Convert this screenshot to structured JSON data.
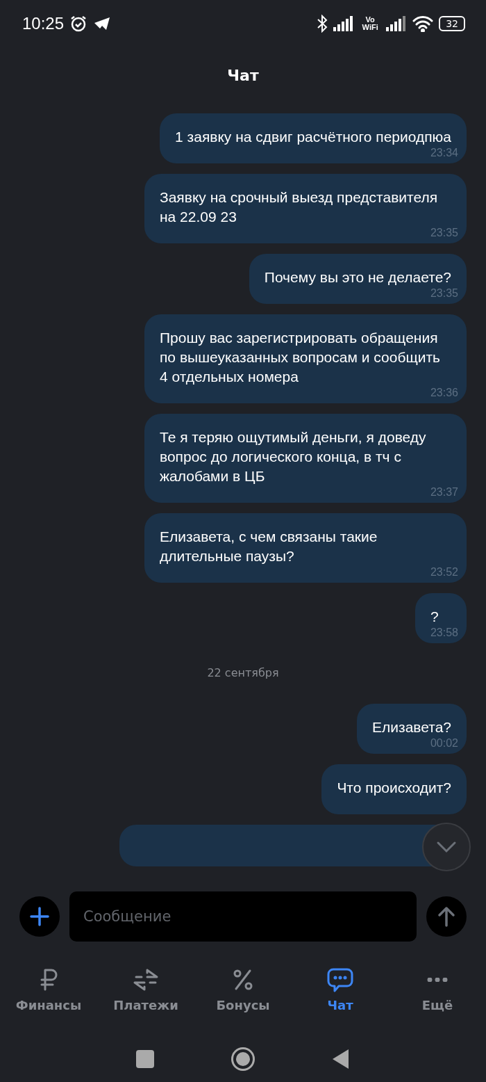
{
  "status_bar": {
    "time": "10:25",
    "network_label": "Vo WiFi",
    "battery": "32"
  },
  "header": {
    "title": "Чат"
  },
  "messages": [
    {
      "kind": "message",
      "text": "1 заявку на сдвиг расчётного периодпюа",
      "time": "23:34"
    },
    {
      "kind": "message",
      "text": "Заявку на срочный выезд представителя на 22.09 23",
      "time": "23:35"
    },
    {
      "kind": "message",
      "text": "Почему вы это не делаете?",
      "time": "23:35"
    },
    {
      "kind": "message",
      "text": "Прошу вас зарегистрировать обращения по вышеуказанных вопросам и сообщить 4 отдельных номера",
      "time": "23:36"
    },
    {
      "kind": "message",
      "text": "Те я теряю ощутимый деньги, я доведу вопрос до логического конца, в тч с жалобами в ЦБ",
      "time": "23:37"
    },
    {
      "kind": "message",
      "text": "Елизавета, с чем связаны такие длительные паузы?",
      "time": "23:52"
    },
    {
      "kind": "message",
      "text": "?",
      "time": "23:58"
    },
    {
      "kind": "date",
      "text": "22 сентября"
    },
    {
      "kind": "message",
      "text": "Елизавета?",
      "time": "00:02"
    },
    {
      "kind": "message",
      "text": "Что происходит?"
    },
    {
      "kind": "partial"
    }
  ],
  "composer": {
    "placeholder": "Сообщение"
  },
  "tabs": [
    {
      "label": "Финансы",
      "selected": false
    },
    {
      "label": "Платежи",
      "selected": false
    },
    {
      "label": "Бонусы",
      "selected": false
    },
    {
      "label": "Чат",
      "selected": true
    },
    {
      "label": "Ещё",
      "selected": false
    }
  ]
}
